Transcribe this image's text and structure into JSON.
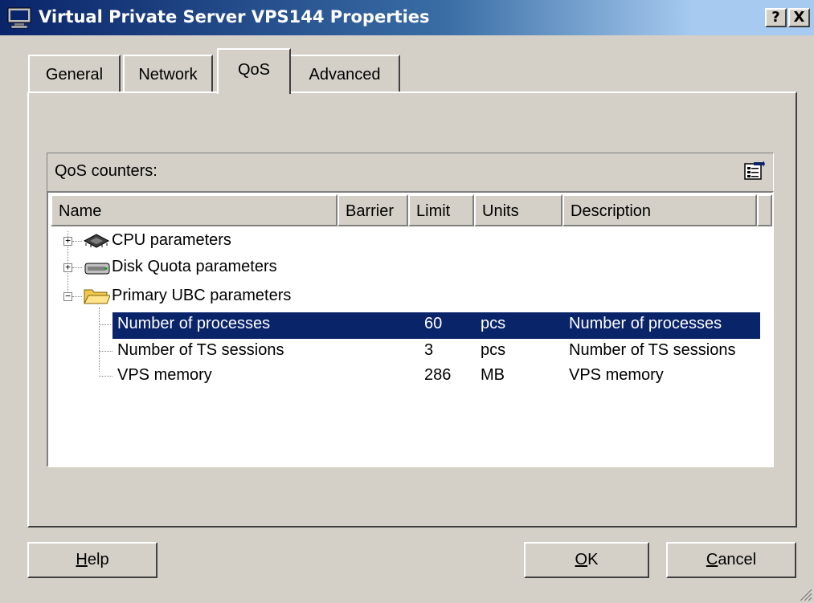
{
  "window": {
    "title": "Virtual Private Server VPS144 Properties",
    "help_btn": "?",
    "close_btn": "X"
  },
  "tabs": [
    {
      "label": "General",
      "active": false
    },
    {
      "label": "Network",
      "active": false
    },
    {
      "label": "QoS",
      "active": true
    },
    {
      "label": "Advanced",
      "active": false
    }
  ],
  "qos": {
    "group_title": "QoS counters:",
    "columns": [
      "Name",
      "Barrier",
      "Limit",
      "Units",
      "Description"
    ],
    "tree": [
      {
        "label": "CPU parameters",
        "icon": "cpu-icon",
        "expanded": false
      },
      {
        "label": "Disk Quota parameters",
        "icon": "disk-icon",
        "expanded": false
      },
      {
        "label": "Primary UBC parameters",
        "icon": "folder-icon",
        "expanded": true,
        "children": [
          {
            "name": "Number of processes",
            "barrier": "",
            "limit": "60",
            "units": "pcs",
            "description": "Number of processes",
            "selected": true
          },
          {
            "name": "Number of TS sessions",
            "barrier": "",
            "limit": "3",
            "units": "pcs",
            "description": "Number of TS sessions",
            "selected": false
          },
          {
            "name": "VPS memory",
            "barrier": "",
            "limit": "286",
            "units": "MB",
            "description": "VPS memory",
            "selected": false
          }
        ]
      }
    ]
  },
  "buttons": {
    "help": {
      "pre": "",
      "accel": "H",
      "post": "elp"
    },
    "ok": {
      "pre": "",
      "accel": "O",
      "post": "K"
    },
    "cancel": {
      "pre": "",
      "accel": "C",
      "post": "ancel"
    }
  },
  "colors": {
    "selection": "#0a246a",
    "face": "#d4d0c8",
    "title_start": "#0a246a",
    "title_end": "#a6caf0"
  }
}
